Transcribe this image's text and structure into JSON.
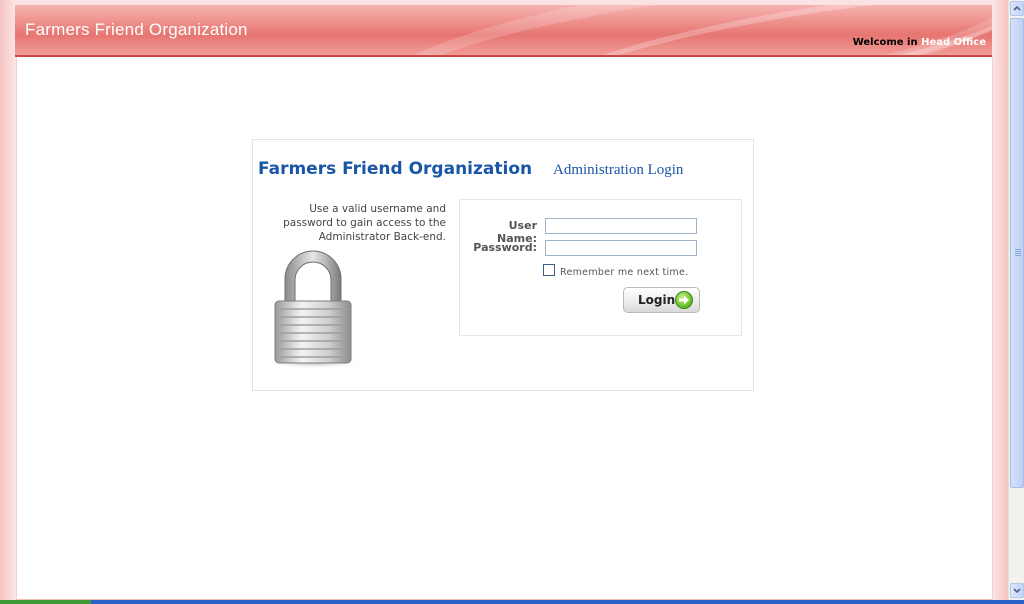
{
  "header": {
    "site_title": "Farmers Friend Organization",
    "welcome_prefix": "Welcome in",
    "office_name": "Head Office"
  },
  "login": {
    "org_title": "Farmers Friend Organization",
    "admin_title": "Administration Login",
    "help_text": "Use a valid username and password to gain access to the Administrator Back-end.",
    "username_label": "User Name:",
    "username_value": "",
    "password_label": "Password:",
    "password_value": "",
    "remember_label": "Remember me next time.",
    "remember_checked": false,
    "login_button": "Login"
  },
  "colors": {
    "header_red": "#e67571",
    "title_blue": "#1a56a8",
    "go_green": "#6dc22d"
  },
  "icons": [
    "padlock-icon",
    "go-arrow-icon",
    "scroll-up-icon",
    "scroll-down-icon"
  ]
}
